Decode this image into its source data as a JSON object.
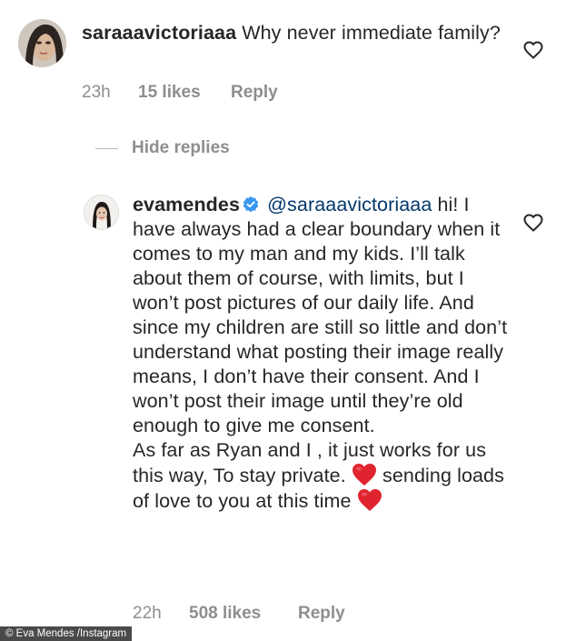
{
  "comments": [
    {
      "username": "saraaavictoriaaa",
      "text": "Why never immediate family?",
      "time": "23h",
      "likes": "15 likes",
      "reply_label": "Reply"
    },
    {
      "username": "evamendes",
      "mention": "@saraaavictoriaaa",
      "paragraph_1": "hi! I have always had a clear boundary when it comes to my man and my kids. I’ll talk about them of course, with limits, but I won’t post pictures of our daily life. And since my children are still so little and don’t understand what posting their image really means, I don’t have their consent. And I won’t post their image until they’re old enough to give me consent.",
      "paragraph_2_a": "As far as Ryan and I , it just works for us this way, To stay private.",
      "paragraph_2_b": "sending loads of love to you at this time",
      "time": "22h",
      "likes": "508 likes",
      "reply_label": "Reply"
    }
  ],
  "hide_replies_label": "Hide replies",
  "photo_credit": "© Eva Mendes /Instagram",
  "icons": {
    "like": "heart-outline-icon",
    "verified": "verified-badge-icon",
    "emoji": "red-heart-emoji"
  },
  "colors": {
    "text": "#262626",
    "meta": "#8e8e8e",
    "mention": "#00376b",
    "verified": "#3897f0",
    "emoji_heart": "#e0242f"
  }
}
